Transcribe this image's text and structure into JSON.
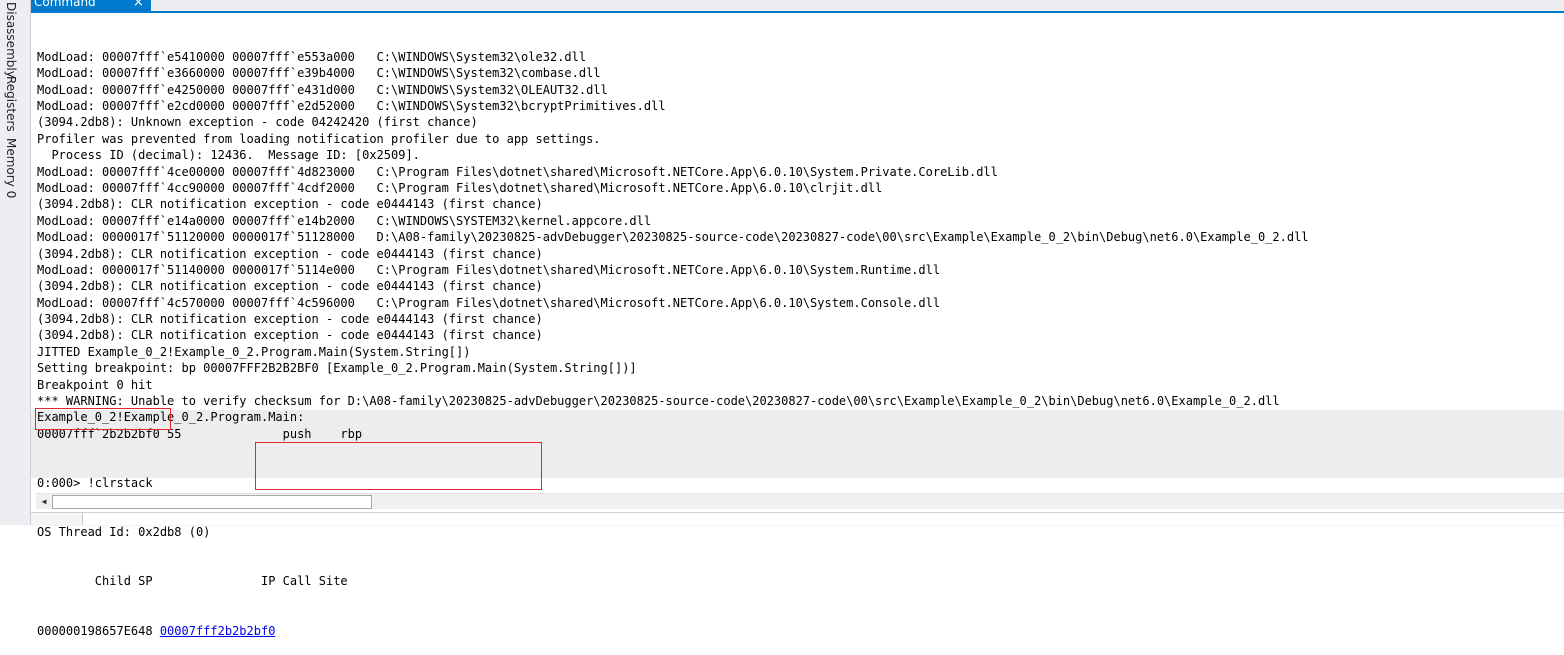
{
  "side_tabs": [
    "Disassembly",
    "Registers",
    "Memory 0"
  ],
  "window": {
    "tab_label": "Command",
    "close_glyph": "×"
  },
  "lines": [
    "ModLoad: 00007fff`e5410000 00007fff`e553a000   C:\\WINDOWS\\System32\\ole32.dll",
    "ModLoad: 00007fff`e3660000 00007fff`e39b4000   C:\\WINDOWS\\System32\\combase.dll",
    "ModLoad: 00007fff`e4250000 00007fff`e431d000   C:\\WINDOWS\\System32\\OLEAUT32.dll",
    "ModLoad: 00007fff`e2cd0000 00007fff`e2d52000   C:\\WINDOWS\\System32\\bcryptPrimitives.dll",
    "(3094.2db8): Unknown exception - code 04242420 (first chance)",
    "Profiler was prevented from loading notification profiler due to app settings.",
    "  Process ID (decimal): 12436.  Message ID: [0x2509].",
    "ModLoad: 00007fff`4ce00000 00007fff`4d823000   C:\\Program Files\\dotnet\\shared\\Microsoft.NETCore.App\\6.0.10\\System.Private.CoreLib.dll",
    "ModLoad: 00007fff`4cc90000 00007fff`4cdf2000   C:\\Program Files\\dotnet\\shared\\Microsoft.NETCore.App\\6.0.10\\clrjit.dll",
    "(3094.2db8): CLR notification exception - code e0444143 (first chance)",
    "ModLoad: 00007fff`e14a0000 00007fff`e14b2000   C:\\WINDOWS\\SYSTEM32\\kernel.appcore.dll",
    "ModLoad: 0000017f`51120000 0000017f`51128000   D:\\A08-family\\20230825-advDebugger\\20230825-source-code\\20230827-code\\00\\src\\Example\\Example_0_2\\bin\\Debug\\net6.0\\Example_0_2.dll",
    "(3094.2db8): CLR notification exception - code e0444143 (first chance)",
    "ModLoad: 0000017f`51140000 0000017f`5114e000   C:\\Program Files\\dotnet\\shared\\Microsoft.NETCore.App\\6.0.10\\System.Runtime.dll",
    "(3094.2db8): CLR notification exception - code e0444143 (first chance)",
    "ModLoad: 00007fff`4c570000 00007fff`4c596000   C:\\Program Files\\dotnet\\shared\\Microsoft.NETCore.App\\6.0.10\\System.Console.dll",
    "(3094.2db8): CLR notification exception - code e0444143 (first chance)",
    "(3094.2db8): CLR notification exception - code e0444143 (first chance)",
    "JITTED Example_0_2!Example_0_2.Program.Main(System.String[])",
    "Setting breakpoint: bp 00007FFF2B2B2BF0 [Example_0_2.Program.Main(System.String[])]",
    "Breakpoint 0 hit",
    "*** WARNING: Unable to verify checksum for D:\\A08-family\\20230825-advDebugger\\20230825-source-code\\20230827-code\\00\\src\\Example\\Example_0_2\\bin\\Debug\\net6.0\\Example_0_2.dll",
    "Example_0_2!Example_0_2.Program.Main:",
    "00007fff`2b2b2bf0 55              push    rbp"
  ],
  "command": {
    "prompt_line": "0:000> !clrstack",
    "thread_line": "OS Thread Id: 0x2db8 (0)",
    "header_line": "        Child SP               IP Call Site",
    "sp_value": "000000198657E648 ",
    "ip_link": "00007fff2b2b2bf0"
  },
  "scrollbar": {
    "left_arrow": "◀"
  }
}
